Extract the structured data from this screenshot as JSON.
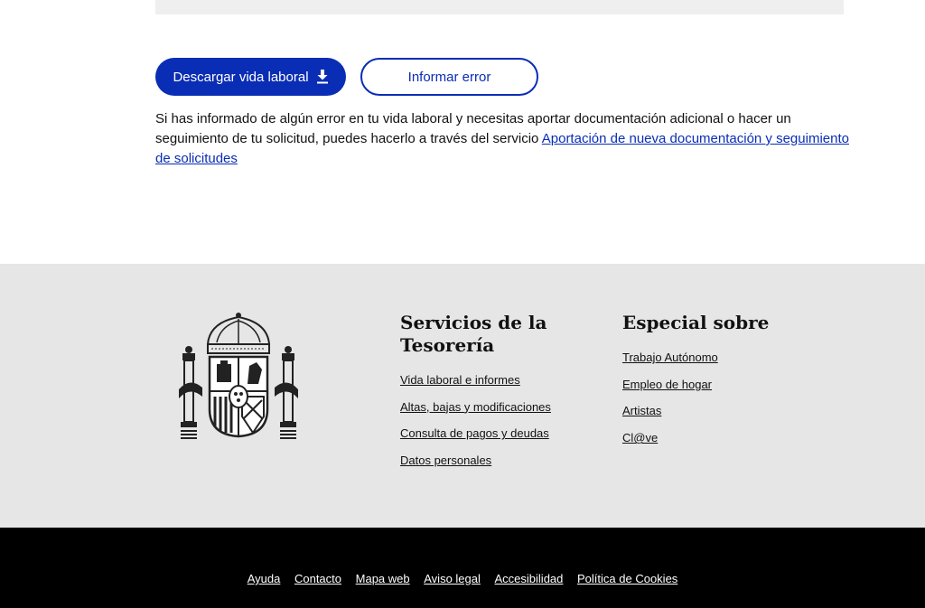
{
  "actions": {
    "download_label": "Descargar vida laboral",
    "report_label": "Informar error"
  },
  "info": {
    "text": "Si has informado de algún error en tu vida laboral y necesitas aportar documentación adicional o hacer un seguimiento de tu solicitud, puedes hacerlo a través del servicio ",
    "link": "Aportación de nueva documentación y seguimiento de solicitudes"
  },
  "footer": {
    "col1": {
      "title": "Servicios de la Tesorería",
      "links": [
        "Vida laboral e informes",
        "Altas, bajas y modificaciones",
        "Consulta de pagos y deudas",
        "Datos personales"
      ]
    },
    "col2": {
      "title": "Especial sobre",
      "links": [
        "Trabajo Autónomo",
        "Empleo de hogar",
        "Artistas",
        "Cl@ve"
      ]
    },
    "bottom_links": [
      "Ayuda",
      "Contacto",
      "Mapa web",
      "Aviso legal",
      "Accesibilidad",
      "Política de Cookies"
    ],
    "emblem_lettering": [
      "PLVS",
      "VLTRA"
    ]
  },
  "colors": {
    "primary": "#0a2db5",
    "footer_bg": "#e6e6e6",
    "bottom_bg": "#000000"
  },
  "icons": {
    "download": "download-icon",
    "emblem": "coat-of-arms-icon"
  }
}
